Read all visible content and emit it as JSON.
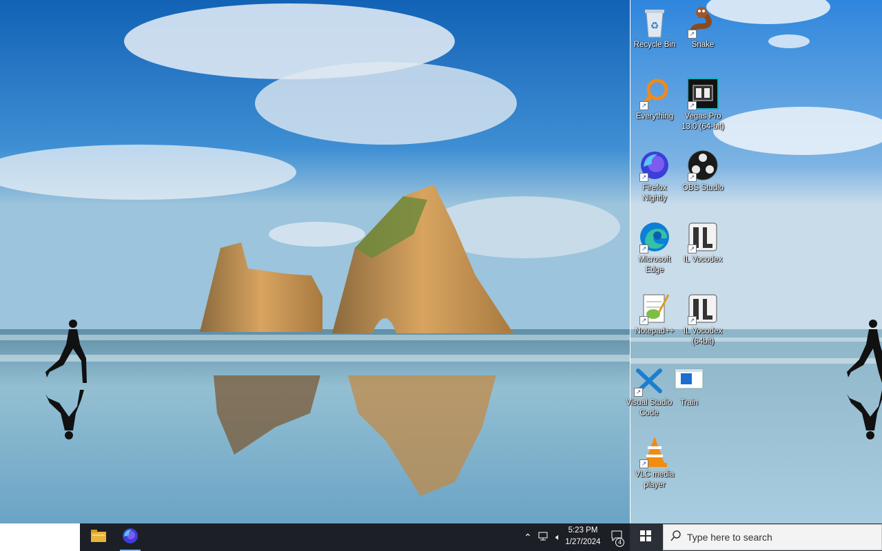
{
  "desktop": {
    "icons": [
      {
        "label": "Recycle Bin",
        "icon": "recycle-bin-icon"
      },
      {
        "label": "Snake",
        "icon": "snake-icon"
      },
      {
        "label": "Everything",
        "icon": "everything-search-icon"
      },
      {
        "label": "Vegas Pro 13.0 (64-bit)",
        "icon": "vegas-pro-icon"
      },
      {
        "label": "Firefox Nightly",
        "icon": "firefox-nightly-icon"
      },
      {
        "label": "OBS Studio",
        "icon": "obs-studio-icon"
      },
      {
        "label": "Microsoft Edge",
        "icon": "microsoft-edge-icon"
      },
      {
        "label": "IL Vocodex",
        "icon": "il-vocodex-icon"
      },
      {
        "label": "Notepad++",
        "icon": "notepad-plus-plus-icon"
      },
      {
        "label": "IL Vocodex (64bit)",
        "icon": "il-vocodex-64-icon"
      },
      {
        "label": "Visual Studio Code",
        "icon": "vscode-icon"
      },
      {
        "label": "Train",
        "icon": "train-icon"
      },
      {
        "label": "VLC media player",
        "icon": "vlc-icon"
      }
    ]
  },
  "taskbar": {
    "pinned": [
      {
        "name": "File Explorer",
        "icon": "folder-icon"
      },
      {
        "name": "Firefox Nightly",
        "icon": "firefox-nightly-icon"
      }
    ],
    "clock": {
      "time": "5:23 PM",
      "date": "1/27/2024"
    },
    "notification_count": "4",
    "search_placeholder": "Type here to search"
  },
  "colors": {
    "taskbar_dark": "#1c1f26",
    "sky_top": "#1b6fc4",
    "sea": "#7fb3c9"
  }
}
